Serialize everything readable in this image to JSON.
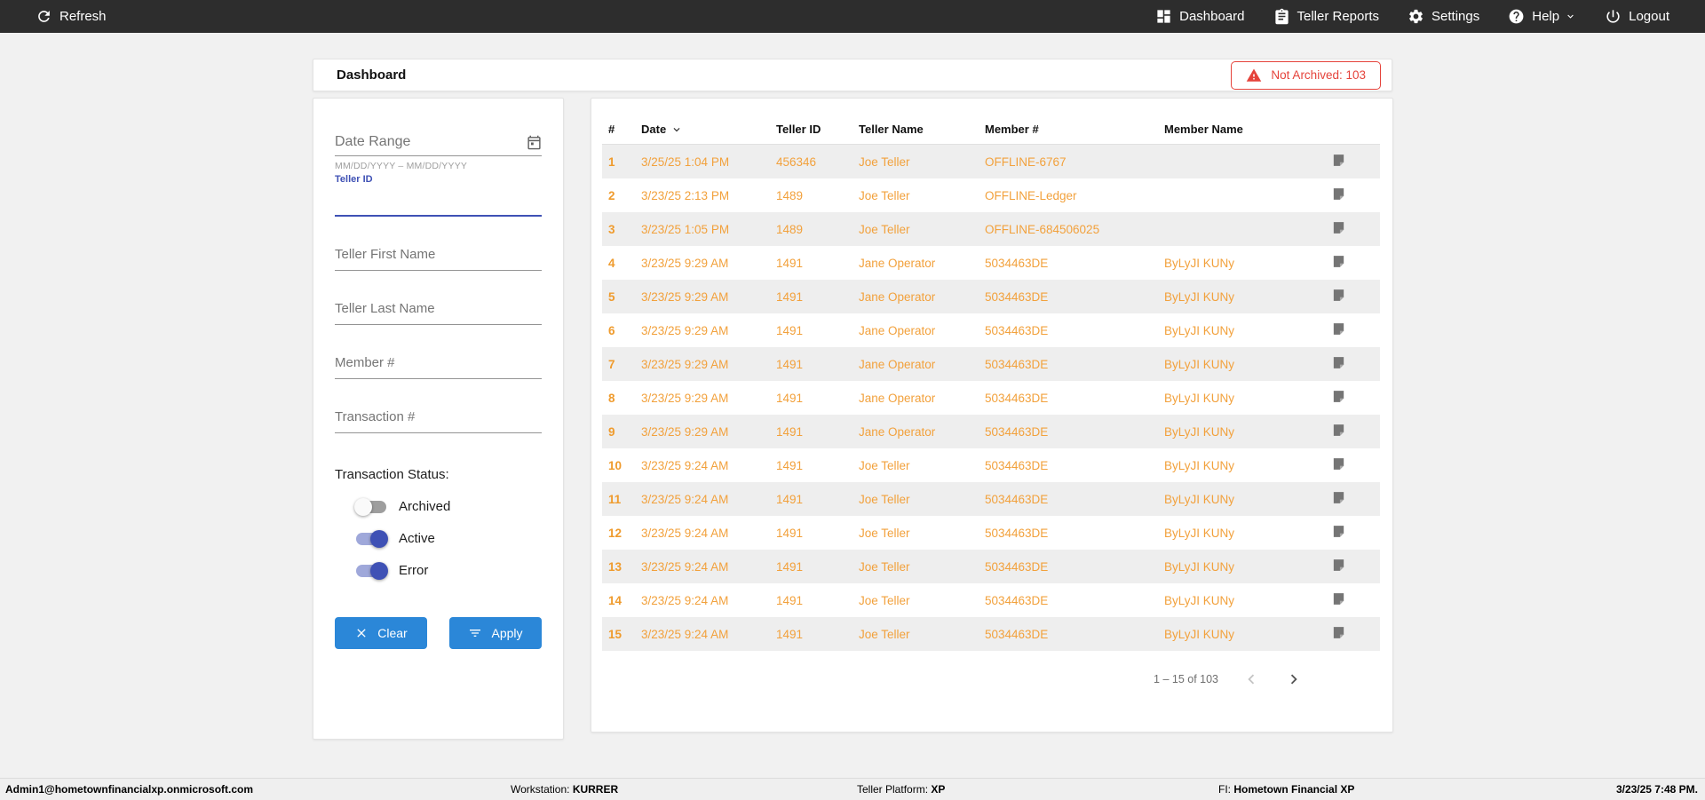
{
  "topbar": {
    "refresh_label": "Refresh",
    "nav": [
      {
        "label": "Dashboard",
        "icon": "dashboard-icon"
      },
      {
        "label": "Teller Reports",
        "icon": "clipboard-icon"
      },
      {
        "label": "Settings",
        "icon": "gear-icon"
      },
      {
        "label": "Help",
        "icon": "help-icon"
      },
      {
        "label": "Logout",
        "icon": "power-icon"
      }
    ]
  },
  "header": {
    "title": "Dashboard",
    "alert_label": "Not Archived: 103"
  },
  "filters": {
    "date_range_label": "Date Range",
    "date_range_helper": "MM/DD/YYYY – MM/DD/YYYY",
    "teller_id_label": "Teller ID",
    "text_fields": [
      {
        "placeholder": "Teller First Name"
      },
      {
        "placeholder": "Teller Last Name"
      },
      {
        "placeholder": "Member #"
      },
      {
        "placeholder": "Transaction #"
      }
    ],
    "status_label": "Transaction Status:",
    "toggles": [
      {
        "label": "Archived",
        "on": false
      },
      {
        "label": "Active",
        "on": true
      },
      {
        "label": "Error",
        "on": true
      }
    ],
    "clear_label": "Clear",
    "apply_label": "Apply"
  },
  "table": {
    "columns": [
      "#",
      "Date",
      "Teller ID",
      "Teller Name",
      "Member #",
      "Member Name"
    ],
    "sorted_column": "Date",
    "sort_direction": "desc",
    "rows": [
      {
        "num": "1",
        "date": "3/25/25 1:04 PM",
        "teller_id": "456346",
        "teller_name": "Joe Teller",
        "member_num": "OFFLINE-6767",
        "member_name": ""
      },
      {
        "num": "2",
        "date": "3/23/25 2:13 PM",
        "teller_id": "1489",
        "teller_name": "Joe Teller",
        "member_num": "OFFLINE-Ledger",
        "member_name": ""
      },
      {
        "num": "3",
        "date": "3/23/25 1:05 PM",
        "teller_id": "1489",
        "teller_name": "Joe Teller",
        "member_num": "OFFLINE-684506025",
        "member_name": ""
      },
      {
        "num": "4",
        "date": "3/23/25 9:29 AM",
        "teller_id": "1491",
        "teller_name": "Jane Operator",
        "member_num": "5034463DE",
        "member_name": "ByLyJI KUNy"
      },
      {
        "num": "5",
        "date": "3/23/25 9:29 AM",
        "teller_id": "1491",
        "teller_name": "Jane Operator",
        "member_num": "5034463DE",
        "member_name": "ByLyJI KUNy"
      },
      {
        "num": "6",
        "date": "3/23/25 9:29 AM",
        "teller_id": "1491",
        "teller_name": "Jane Operator",
        "member_num": "5034463DE",
        "member_name": "ByLyJI KUNy"
      },
      {
        "num": "7",
        "date": "3/23/25 9:29 AM",
        "teller_id": "1491",
        "teller_name": "Jane Operator",
        "member_num": "5034463DE",
        "member_name": "ByLyJI KUNy"
      },
      {
        "num": "8",
        "date": "3/23/25 9:29 AM",
        "teller_id": "1491",
        "teller_name": "Jane Operator",
        "member_num": "5034463DE",
        "member_name": "ByLyJI KUNy"
      },
      {
        "num": "9",
        "date": "3/23/25 9:29 AM",
        "teller_id": "1491",
        "teller_name": "Jane Operator",
        "member_num": "5034463DE",
        "member_name": "ByLyJI KUNy"
      },
      {
        "num": "10",
        "date": "3/23/25 9:24 AM",
        "teller_id": "1491",
        "teller_name": "Joe Teller",
        "member_num": "5034463DE",
        "member_name": "ByLyJI KUNy"
      },
      {
        "num": "11",
        "date": "3/23/25 9:24 AM",
        "teller_id": "1491",
        "teller_name": "Joe Teller",
        "member_num": "5034463DE",
        "member_name": "ByLyJI KUNy"
      },
      {
        "num": "12",
        "date": "3/23/25 9:24 AM",
        "teller_id": "1491",
        "teller_name": "Joe Teller",
        "member_num": "5034463DE",
        "member_name": "ByLyJI KUNy"
      },
      {
        "num": "13",
        "date": "3/23/25 9:24 AM",
        "teller_id": "1491",
        "teller_name": "Joe Teller",
        "member_num": "5034463DE",
        "member_name": "ByLyJI KUNy"
      },
      {
        "num": "14",
        "date": "3/23/25 9:24 AM",
        "teller_id": "1491",
        "teller_name": "Joe Teller",
        "member_num": "5034463DE",
        "member_name": "ByLyJI KUNy"
      },
      {
        "num": "15",
        "date": "3/23/25 9:24 AM",
        "teller_id": "1491",
        "teller_name": "Joe Teller",
        "member_num": "5034463DE",
        "member_name": "ByLyJI KUNy"
      }
    ],
    "row_note_icon": "note-icon",
    "pagination": {
      "range_text": "1 – 15 of 103"
    }
  },
  "footer": {
    "user": "Admin1@hometownfinancialxp.onmicrosoft.com",
    "workstation_label": "Workstation:",
    "workstation_value": "KURRER",
    "platform_label": "Teller Platform:",
    "platform_value": "XP",
    "fi_label": "FI:",
    "fi_value": "Hometown Financial XP",
    "datetime": "3/23/25 7:48 PM."
  },
  "colors": {
    "topbar_bg": "#2d2d2d",
    "accent_blue": "#2b87d8",
    "toggle_on": "#3f51b5",
    "toggle_track_on": "#9fa8da",
    "row_text_orange": "#f2a13c",
    "alert_red": "#e5433b",
    "stripe_gray": "#eeeeee"
  }
}
